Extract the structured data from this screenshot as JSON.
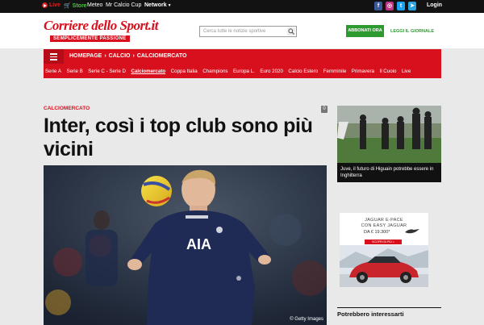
{
  "topbar": {
    "live": "Live",
    "store": "Store",
    "meteo": "Meteo",
    "mr_calcio_cup": "Mr Calcio Cup",
    "network": "Network",
    "login": "Login",
    "social": [
      "facebook",
      "instagram",
      "twitter",
      "telegram"
    ]
  },
  "header": {
    "logo_line1": "Corriere dello Sport.it",
    "logo_tagline": "SEMPLICEMENTE PASSIONE",
    "search_placeholder": "Cerca tutte le notizie sportive",
    "subscribe": "ABBONATI ORA",
    "read_paper": "LEGGI IL GIORNALE"
  },
  "nav": {
    "breadcrumb": [
      "HOMEPAGE",
      "CALCIO",
      "CALCIOMERCATO"
    ],
    "items": [
      "Serie A",
      "Serie B",
      "Serie C - Serie D",
      "Calciomercato",
      "Coppa Italia",
      "Champions",
      "Europa L.",
      "Euro 2020",
      "Calcio Estero",
      "Femminile",
      "Primavera",
      "Il Cuoio",
      "Live"
    ],
    "active": "Calciomercato"
  },
  "article": {
    "category": "CALCIOMERCATO",
    "comment_count": "0",
    "headline": "Inter, così i top club sono più vicini",
    "photo_credit": "© Getty Images",
    "jersey_text": "AIA"
  },
  "sidebar": {
    "related_title": "Juve, il futuro di Higuain potrebbe essere in Inghilterra",
    "ad_line1": "JAGUAR E-PACE",
    "ad_line2": "CON EASY JAGUAR",
    "ad_price": "DA € 19.300*",
    "ad_cta": "SCOPRI DI PIÙ >",
    "might_interest": "Potrebbero interessarti"
  },
  "colors": {
    "brand_red": "#d8101d",
    "green": "#2d9a2f"
  }
}
